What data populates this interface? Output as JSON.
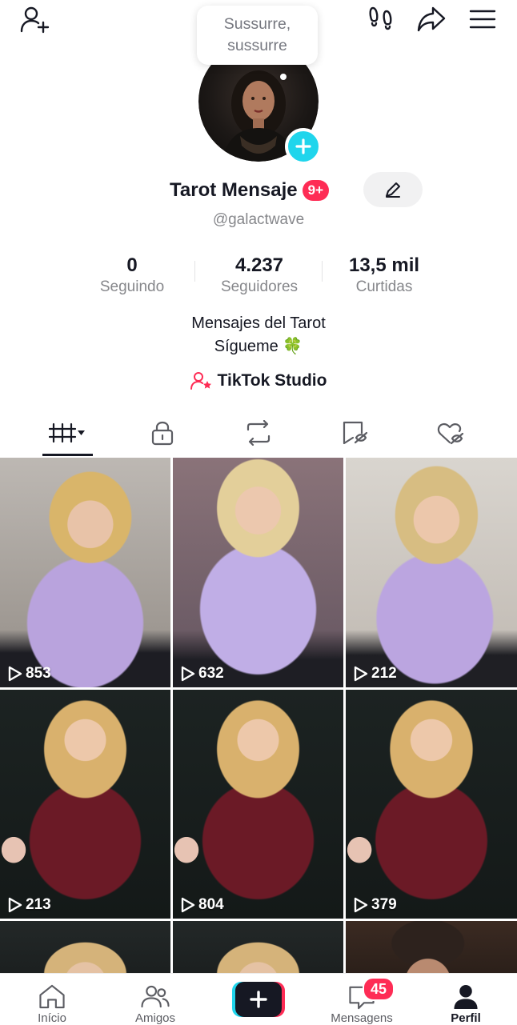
{
  "tooltip": {
    "text": "Sussurre, sussurre"
  },
  "profile": {
    "name": "Tarot Mensaje",
    "notifications_badge": "9+",
    "handle": "@galactwave",
    "bio_line1": "Mensajes del Tarot",
    "bio_line2": "Sígueme 🍀",
    "studio_label": "TikTok Studio"
  },
  "stats": [
    {
      "value": "0",
      "label": "Seguindo"
    },
    {
      "value": "4.237",
      "label": "Seguidores"
    },
    {
      "value": "13,5 mil",
      "label": "Curtidas"
    }
  ],
  "tabs": [
    {
      "icon": "videos-grid-icon",
      "active": true
    },
    {
      "icon": "lock-icon",
      "active": false
    },
    {
      "icon": "repost-icon",
      "active": false
    },
    {
      "icon": "saved-hidden-icon",
      "active": false
    },
    {
      "icon": "liked-hidden-icon",
      "active": false
    }
  ],
  "videos": [
    {
      "views": "853",
      "theme": "lilac"
    },
    {
      "views": "632",
      "theme": "lilac"
    },
    {
      "views": "212",
      "theme": "lilac"
    },
    {
      "views": "213",
      "theme": "wine"
    },
    {
      "views": "804",
      "theme": "wine"
    },
    {
      "views": "379",
      "theme": "wine"
    },
    {
      "views": "",
      "theme": "dark"
    },
    {
      "views": "",
      "theme": "dark"
    },
    {
      "views": "",
      "theme": "dark"
    }
  ],
  "nav": {
    "home": "Início",
    "friends": "Amigos",
    "messages": "Mensagens",
    "messages_badge": "45",
    "profile": "Perfil"
  },
  "colors": {
    "accent": "#fe2c55",
    "cyan": "#20d5ec",
    "text": "#161823",
    "secondary": "#86878b"
  }
}
